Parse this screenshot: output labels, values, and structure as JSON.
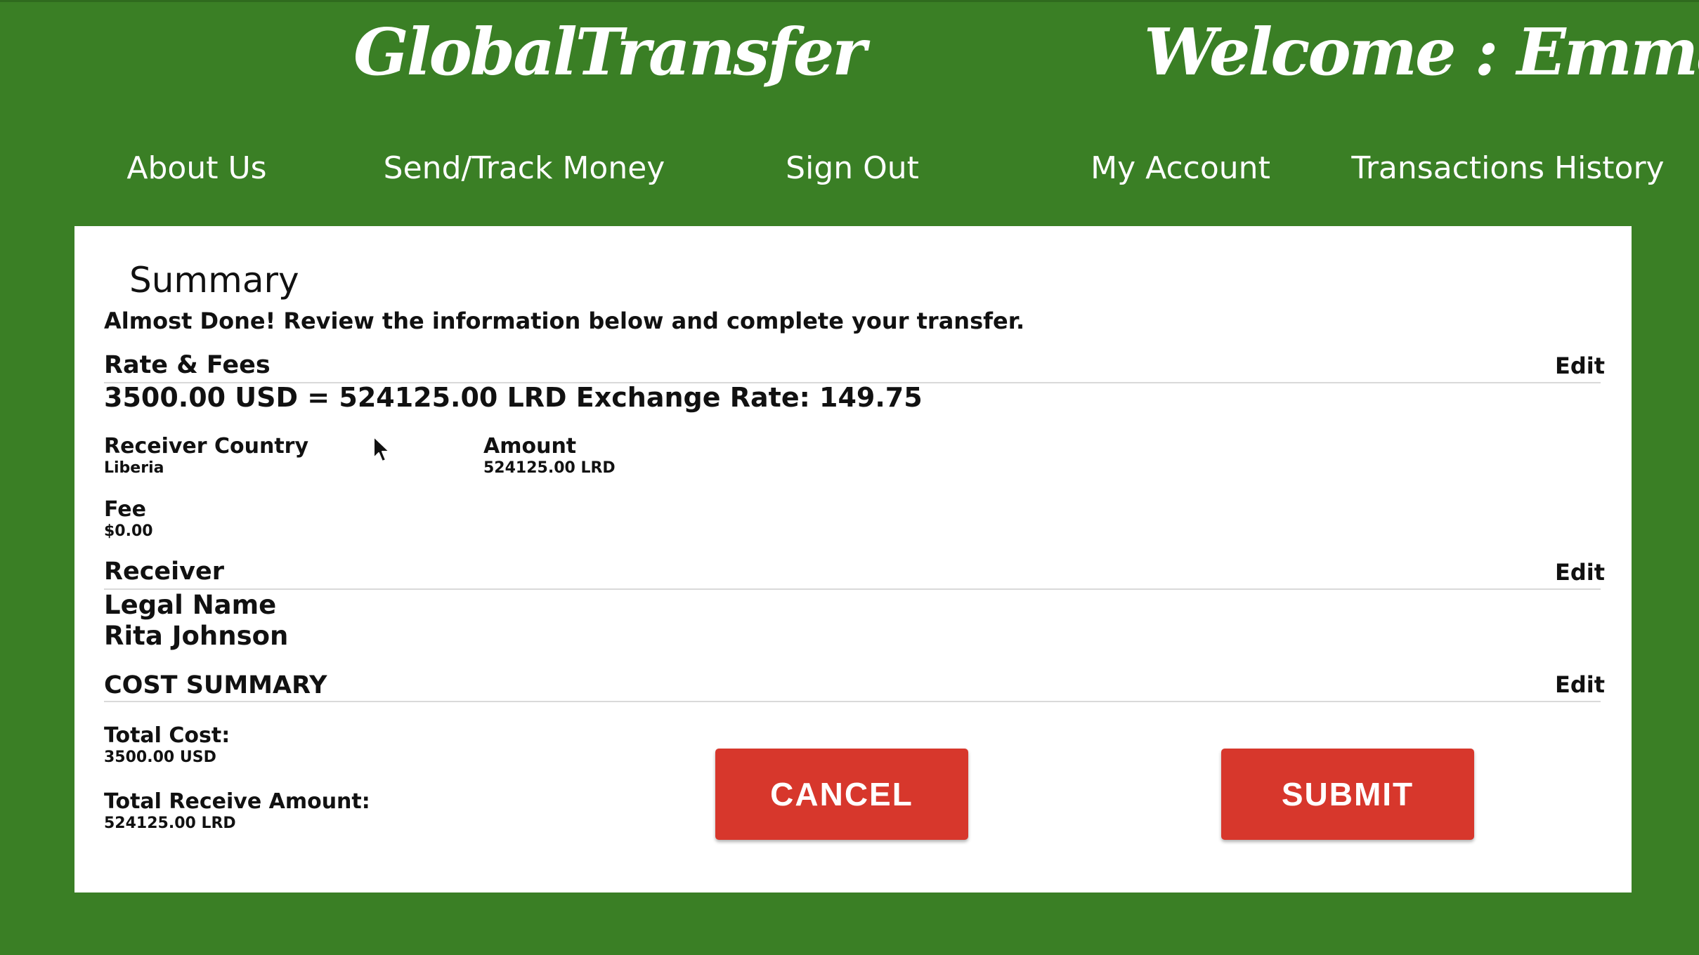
{
  "header": {
    "logo": "GlobalTransfer",
    "welcome": "Welcome : Emma"
  },
  "nav": {
    "items": [
      {
        "label": "About Us"
      },
      {
        "label": "Send/Track Money"
      },
      {
        "label": "Sign Out"
      },
      {
        "label": "My Account"
      },
      {
        "label": "Transactions History"
      }
    ]
  },
  "summary": {
    "title": "Summary",
    "subtitle": "Almost Done! Review the information below and complete your transfer.",
    "edit_label": "Edit",
    "rate_fees": {
      "heading": "Rate & Fees",
      "rate_line": "3500.00 USD = 524125.00 LRD Exchange Rate: 149.75",
      "receiver_country_label": "Receiver Country",
      "receiver_country_value": "Liberia",
      "amount_label": "Amount",
      "amount_value": "524125.00 LRD",
      "fee_label": "Fee",
      "fee_value": "$0.00"
    },
    "receiver": {
      "heading": "Receiver",
      "legal_name_label": "Legal Name",
      "legal_name_value": "Rita Johnson"
    },
    "cost_summary": {
      "heading": "COST SUMMARY",
      "total_cost_label": "Total Cost:",
      "total_cost_value": "3500.00 USD",
      "total_receive_label": "Total Receive Amount:",
      "total_receive_value": "524125.00 LRD"
    }
  },
  "actions": {
    "cancel_label": "CANCEL",
    "submit_label": "SUBMIT"
  }
}
